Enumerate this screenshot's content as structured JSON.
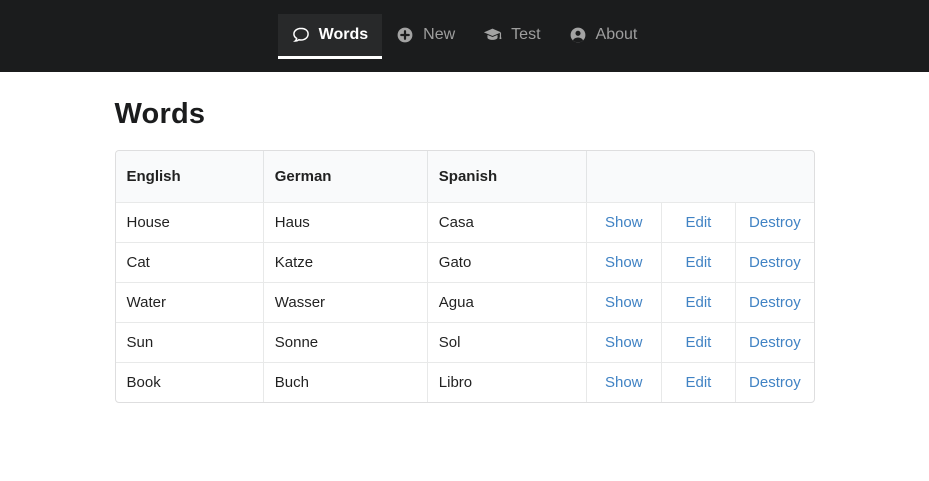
{
  "nav": {
    "items": [
      {
        "label": "Words",
        "icon": "comment-icon",
        "active": true
      },
      {
        "label": "New",
        "icon": "plus-circle-icon",
        "active": false
      },
      {
        "label": "Test",
        "icon": "graduation-cap-icon",
        "active": false
      },
      {
        "label": "About",
        "icon": "user-circle-icon",
        "active": false
      }
    ]
  },
  "page": {
    "title": "Words"
  },
  "table": {
    "headers": [
      "English",
      "German",
      "Spanish"
    ],
    "actions": [
      "Show",
      "Edit",
      "Destroy"
    ],
    "rows": [
      {
        "english": "House",
        "german": "Haus",
        "spanish": "Casa"
      },
      {
        "english": "Cat",
        "german": "Katze",
        "spanish": "Gato"
      },
      {
        "english": "Water",
        "german": "Wasser",
        "spanish": "Agua"
      },
      {
        "english": "Sun",
        "german": "Sonne",
        "spanish": "Sol"
      },
      {
        "english": "Book",
        "german": "Buch",
        "spanish": "Libro"
      }
    ]
  },
  "colors": {
    "navbar_background": "#1b1c1d",
    "nav_inactive_text": "#9e9e9e",
    "nav_active_text": "#ffffff",
    "active_underline": "#ffffff",
    "link": "#4183c4",
    "table_header_background": "#f9fafb",
    "table_border": "#d4d4d5"
  }
}
